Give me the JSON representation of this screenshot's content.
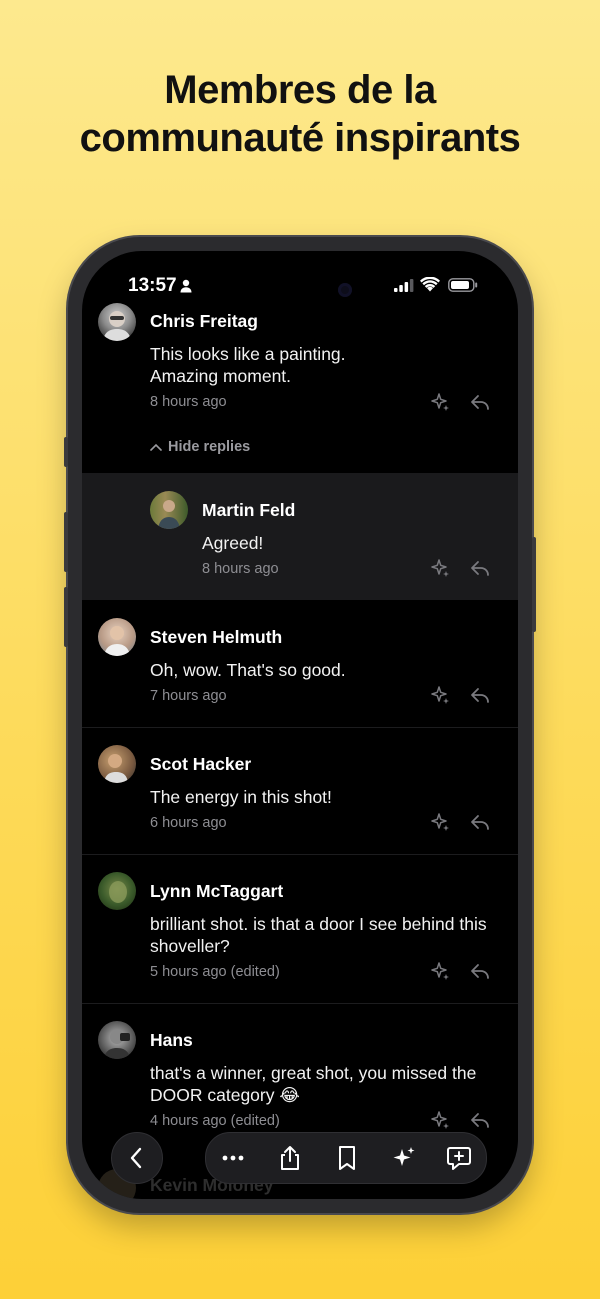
{
  "headline": {
    "line1": "Membres de la",
    "line2": "communauté inspirants"
  },
  "status_bar": {
    "time": "13:57"
  },
  "comments": [
    {
      "name": "Chris Freitag",
      "text": "This looks like a painting. Amazing moment.",
      "time": "8 hours ago"
    },
    {
      "name": "Martin Feld",
      "text": "Agreed!",
      "time": "8 hours ago"
    },
    {
      "name": "Steven Helmuth",
      "text": "Oh, wow.  That's so good.",
      "time": "7 hours ago"
    },
    {
      "name": "Scot Hacker",
      "text": "The energy in this shot!",
      "time": "6 hours ago"
    },
    {
      "name": "Lynn McTaggart",
      "text": "brilliant shot.  is that a door I see behind this shoveller?",
      "time": "5 hours ago (edited)"
    },
    {
      "name": "Hans",
      "text": "that's a winner, great shot, you missed the DOOR category 😂",
      "time": "4 hours ago (edited)"
    },
    {
      "name": "Kevin Moloney"
    }
  ],
  "hide_replies_label": "Hide replies",
  "icons": {
    "appreciate": "sparkle-icon",
    "reply": "reply-arrow-icon",
    "back": "chevron-left-icon",
    "more": "ellipsis-icon",
    "share": "share-icon",
    "bookmark": "bookmark-icon",
    "ai": "sparkles-icon",
    "comment": "add-comment-icon"
  },
  "colors": {
    "background_top": "#fde98e",
    "background_bottom": "#fdd037",
    "screen": "#000000",
    "reply_highlight": "#1a1a1c"
  }
}
